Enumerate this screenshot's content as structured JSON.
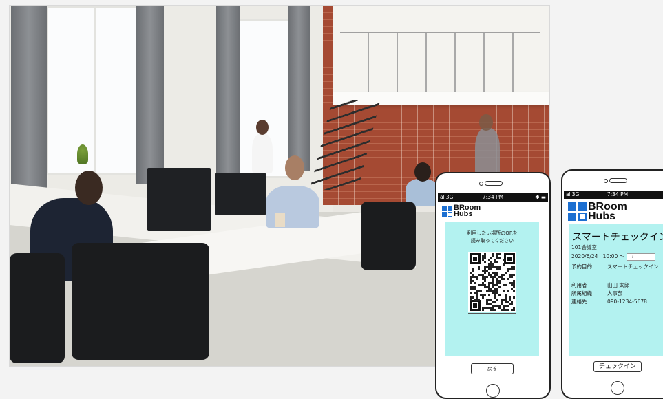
{
  "phone1": {
    "status": {
      "signal": "all3G",
      "time": "7:34 PM",
      "battery": "✱ ▬"
    },
    "logo": {
      "line1": "BRoom",
      "line2": "Hubs"
    },
    "prompt_line1": "利用したい場所のQRを",
    "prompt_line2": "読み取ってください",
    "back_label": "戻る"
  },
  "phone2": {
    "status": {
      "signal": "all3G",
      "time": "7:34 PM"
    },
    "logo": {
      "line1": "BRoom",
      "line2": "Hubs"
    },
    "title": "スマートチェックイン",
    "room": "101会議室",
    "date": "2020/6/24",
    "start_time": "10:00 ～",
    "end_time_placeholder": "--:--",
    "purpose_label": "予約目的:",
    "purpose_value": "スマートチェックイン",
    "user_label": "利用者",
    "user_value": "山田 太郎",
    "org_label": "所属組織",
    "org_value": "人事部",
    "contact_label": "連絡先:",
    "contact_value": "090-1234-5678",
    "checkin_label": "チェックイン"
  },
  "colors": {
    "screen_bg": "#b3f2f0",
    "logo_blue": "#1c6fd1"
  }
}
